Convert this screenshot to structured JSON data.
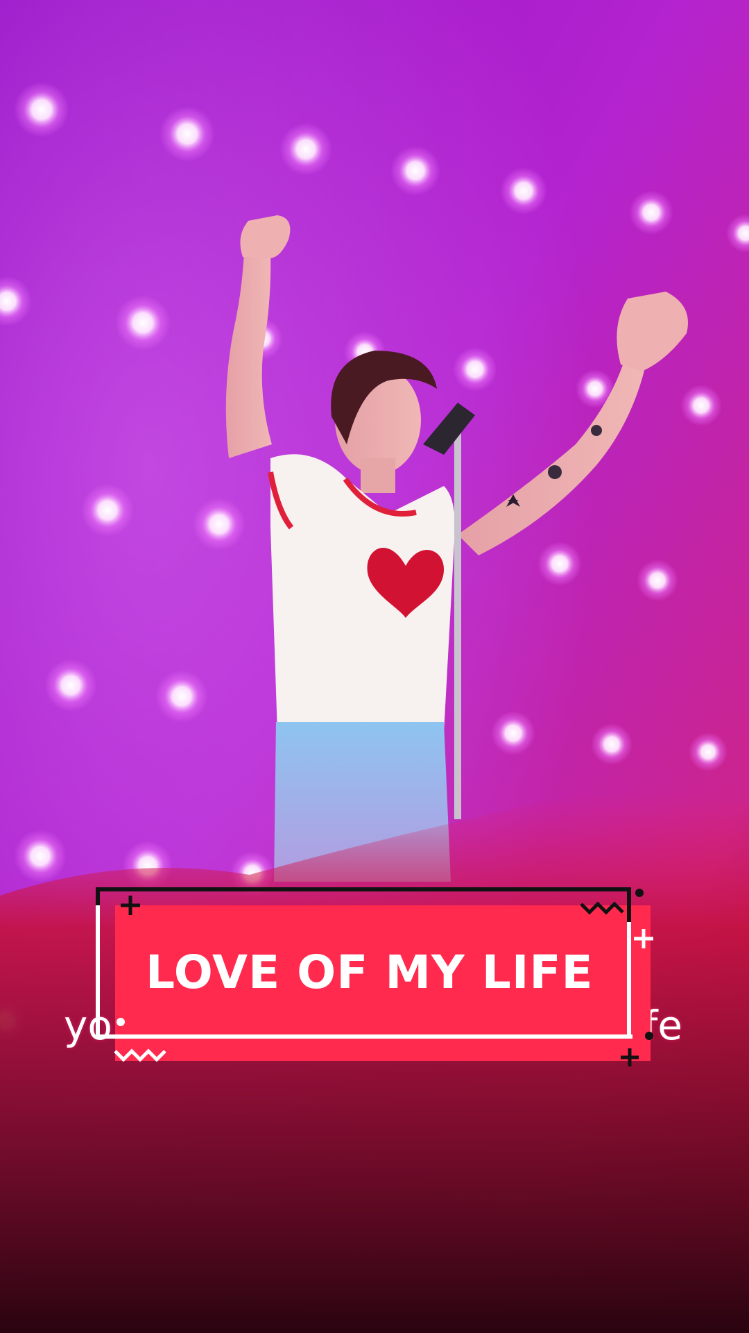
{
  "overlay": {
    "title": "LOVE OF MY LIFE",
    "caption_left": "yo",
    "caption_right": "fe"
  },
  "colors": {
    "stage_background": "#9b14c7",
    "title_card": "#ff2a4e",
    "title_text": "#ffffff",
    "lights": "#fff2ff"
  }
}
